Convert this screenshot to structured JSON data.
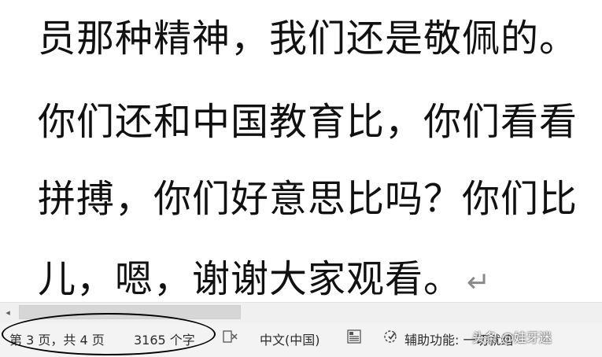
{
  "document": {
    "lines": [
      "员那种精神，我们还是敬佩的。",
      "你们还和中国教育比，你们看看",
      "拼搏，你们好意思比吗？你们比",
      "儿，嗯，谢谢大家观看。"
    ],
    "paragraph_mark": "↵"
  },
  "scrollbar": {
    "left_arrow": "◂"
  },
  "statusbar": {
    "page_info": "第 3 页，共 4 页",
    "word_count": "3165 个字",
    "language": "中文(中国)",
    "accessibility": "辅助功能: 一切就绪"
  },
  "watermark": "头条 @娃牙迷"
}
